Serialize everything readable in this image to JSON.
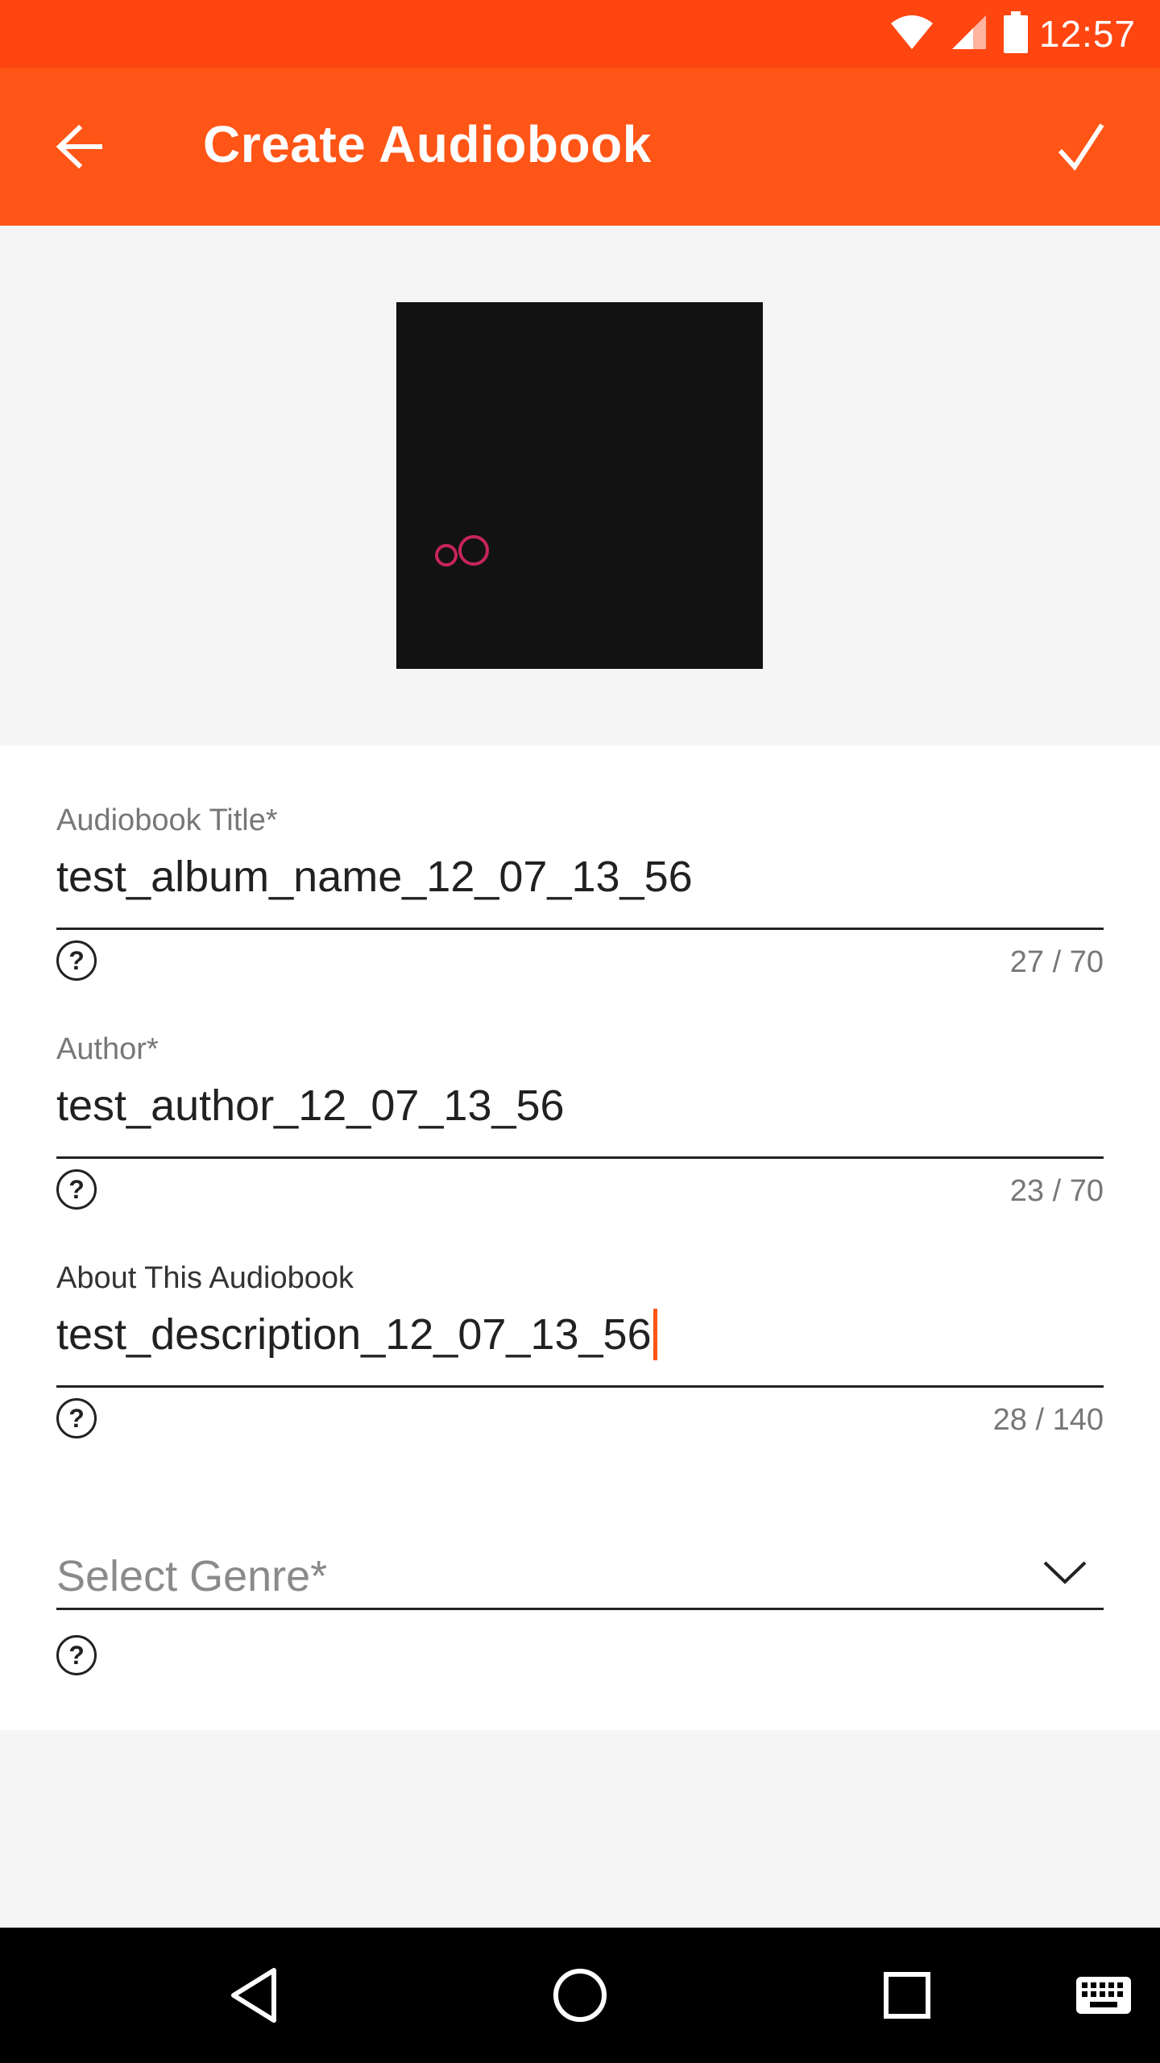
{
  "status_bar": {
    "time": "12:57",
    "icons": [
      "wifi-icon",
      "signal-icon",
      "battery-icon"
    ]
  },
  "app_bar": {
    "title": "Create Audiobook",
    "back_icon": "arrow-back-icon",
    "done_icon": "checkmark-icon"
  },
  "cover": {
    "logo_text": "oO",
    "logo_color": "#c8245c",
    "background": "#121212"
  },
  "form": {
    "title_field": {
      "label": "Audiobook Title*",
      "value": "test_album_name_12_07_13_56",
      "counter": "27 / 70"
    },
    "author_field": {
      "label": "Author*",
      "value": "test_author_12_07_13_56",
      "counter": "23 / 70"
    },
    "about_field": {
      "label": "About This Audiobook",
      "value": "test_description_12_07_13_56",
      "counter": "28 / 140"
    },
    "genre_field": {
      "placeholder": "Select Genre*"
    },
    "help_glyph": "?"
  },
  "colors": {
    "status_bar": "#ff4510",
    "app_bar": "#ff5516",
    "cursor": "#ff5516"
  },
  "nav_bar": {
    "icons": [
      "back-triangle-icon",
      "home-circle-icon",
      "recents-square-icon",
      "keyboard-icon"
    ]
  }
}
